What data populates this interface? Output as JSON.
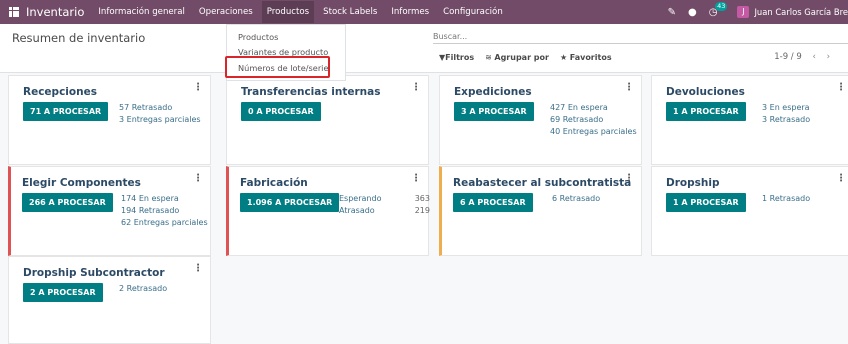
{
  "navbar": {
    "app_name": "Inventario",
    "menu": [
      "Información general",
      "Operaciones",
      "Productos",
      "Stock Labels",
      "Informes",
      "Configuración"
    ],
    "activity_count": "43",
    "avatar_letter": "J",
    "user_name": "Juan Carlos García Bre"
  },
  "control": {
    "title": "Resumen de inventario",
    "search_placeholder": "Buscar...",
    "filters_label": "Filtros",
    "group_label": "Agrupar por",
    "favorites_label": "Favoritos",
    "pager": "1-9 / 9"
  },
  "dropdown": {
    "items": [
      "Productos",
      "Variantes de producto",
      "Números de lote/serie"
    ]
  },
  "cards": [
    {
      "title": "Recepciones",
      "button": "71 A PROCESAR",
      "stats": [
        "57 Retrasado",
        "3 Entregas parciales"
      ]
    },
    {
      "title": "Transferencias internas",
      "button": "0 A PROCESAR",
      "stats": []
    },
    {
      "title": "Expediciones",
      "button": "3 A PROCESAR",
      "stats": [
        "427 En espera",
        "69 Retrasado",
        "40 Entregas parciales"
      ]
    },
    {
      "title": "Devoluciones",
      "button": "1 A PROCESAR",
      "stats": [
        "3 En espera",
        "3 Retrasado"
      ]
    },
    {
      "title": "Elegir Componentes",
      "button": "266 A PROCESAR",
      "stats": [
        "174 En espera",
        "194 Retrasado",
        "62 Entregas parciales"
      ]
    },
    {
      "title": "Fabricación",
      "button": "1.096 A PROCESAR",
      "stats": [
        "Esperando",
        "Atrasado"
      ],
      "numbers": [
        "363",
        "219"
      ]
    },
    {
      "title": "Reabastecer al subcontratista",
      "button": "6 A PROCESAR",
      "stats": [
        "6 Retrasado"
      ]
    },
    {
      "title": "Dropship",
      "button": "1 A PROCESAR",
      "stats": [
        "1 Retrasado"
      ]
    },
    {
      "title": "Dropship Subcontractor",
      "button": "2 A PROCESAR",
      "stats": [
        "2 Retrasado"
      ]
    }
  ],
  "colors": {
    "navbar": "#714b67",
    "button": "#017e84",
    "title": "#2c4a66",
    "late_border": "#e05355",
    "warning_border": "#f0ad4e",
    "highlight": "#d9262a"
  }
}
